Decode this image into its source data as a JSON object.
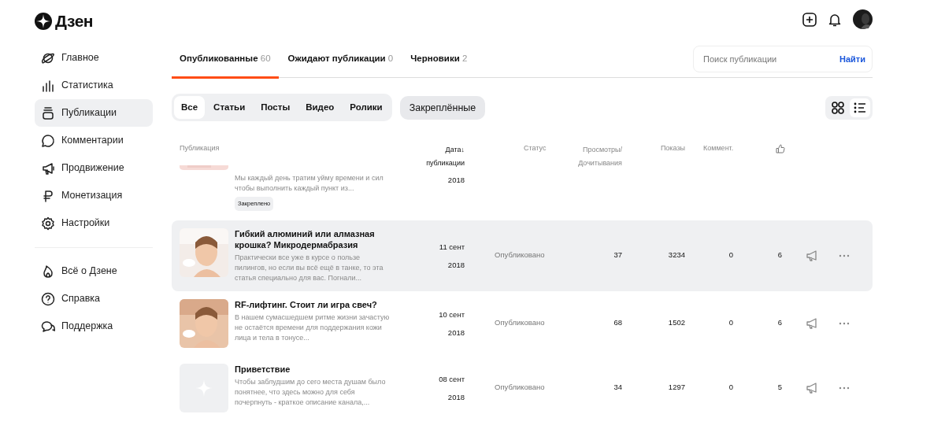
{
  "header": {
    "logo": "Дзен"
  },
  "sidebar": {
    "items": [
      {
        "label": "Главное",
        "selected": false
      },
      {
        "label": "Статистика",
        "selected": false
      },
      {
        "label": "Публикации",
        "selected": true
      },
      {
        "label": "Комментарии",
        "selected": false
      },
      {
        "label": "Продвижение",
        "selected": false
      },
      {
        "label": "Монетизация",
        "selected": false
      },
      {
        "label": "Настройки",
        "selected": false
      }
    ],
    "help_items": [
      {
        "label": "Всё о Дзене"
      },
      {
        "label": "Справка"
      },
      {
        "label": "Поддержка"
      }
    ]
  },
  "tabs": [
    {
      "label": "Опубликованные",
      "count": "60",
      "selected": true
    },
    {
      "label": "Ожидают публикации",
      "count": "0",
      "selected": false
    },
    {
      "label": "Черновики",
      "count": "2",
      "selected": false
    }
  ],
  "search": {
    "placeholder": "Поиск публикации",
    "button": "Найти"
  },
  "filters": [
    {
      "label": "Все",
      "selected": true
    },
    {
      "label": "Статьи",
      "selected": false
    },
    {
      "label": "Посты",
      "selected": false
    },
    {
      "label": "Видео",
      "selected": false
    },
    {
      "label": "Ролики",
      "selected": false
    }
  ],
  "pinned_button": "Закреплённые",
  "view_modes": [
    {
      "kind": "grid",
      "selected": false
    },
    {
      "kind": "list",
      "selected": true
    }
  ],
  "table": {
    "columns": [
      "Публикация",
      "Дата↓ публикации",
      "Статус",
      "Просмотры/ Дочитывания",
      "Показы",
      "Коммент."
    ],
    "rows": [
      {
        "kind": "partial",
        "description": "Мы каждый день тратим уйму времени и сил чтобы выполнить каждый пункт из...",
        "tag": "Закреплено",
        "date_year": "2018",
        "highlighted": false
      },
      {
        "title": "Гибкий алюминий или алмазная крошка? Микродермабразия",
        "description": "Практически все уже в курсе о пользе пилингов, но если вы всё ещё в танке, то эта статья специально для вас. Погнали...",
        "date_day": "11 сент",
        "date_year": "2018",
        "status": "Опубликовано",
        "views": "37",
        "shows": "3234",
        "comments": "0",
        "likes": "6",
        "highlighted": true
      },
      {
        "title": "RF-лифтинг. Стоит ли игра свеч?",
        "description": "В нашем сумасшедшем ритме жизни зачастую не остаётся времени для поддержания кожи лица и тела в тонусе...",
        "date_day": "10 сент",
        "date_year": "2018",
        "status": "Опубликовано",
        "views": "68",
        "shows": "1502",
        "comments": "0",
        "likes": "6",
        "highlighted": false
      },
      {
        "kind": "placeholder",
        "title": "Приветствие",
        "description": "Чтобы заблудшим до сего места душам было понятнее, что здесь можно для себя почерпнуть - краткое описание канала,...",
        "date_day": "08 сент",
        "date_year": "2018",
        "status": "Опубликовано",
        "views": "34",
        "shows": "1297",
        "comments": "0",
        "likes": "5",
        "highlighted": false
      }
    ]
  }
}
